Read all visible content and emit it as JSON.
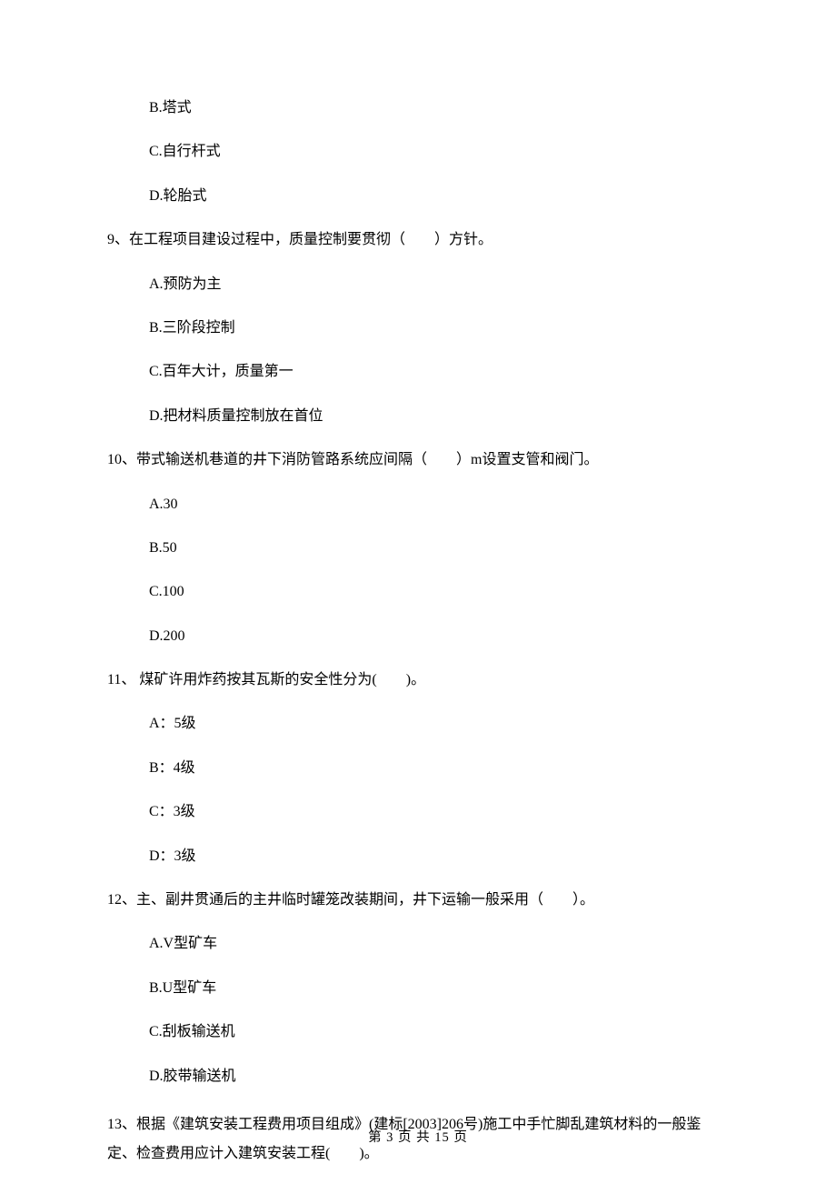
{
  "q8": {
    "opt_b": "B.塔式",
    "opt_c": "C.自行杆式",
    "opt_d": "D.轮胎式"
  },
  "q9": {
    "stem": "9、在工程项目建设过程中，质量控制要贯彻（　　）方针。",
    "opt_a": "A.预防为主",
    "opt_b": "B.三阶段控制",
    "opt_c": "C.百年大计，质量第一",
    "opt_d": "D.把材料质量控制放在首位"
  },
  "q10": {
    "stem": "10、带式输送机巷道的井下消防管路系统应间隔（　　）m设置支管和阀门。",
    "opt_a": "A.30",
    "opt_b": "B.50",
    "opt_c": "C.100",
    "opt_d": "D.200"
  },
  "q11": {
    "stem": "11、 煤矿许用炸药按其瓦斯的安全性分为(　　)。",
    "opt_a": "A：5级",
    "opt_b": "B：4级",
    "opt_c": "C：3级",
    "opt_d": "D：3级"
  },
  "q12": {
    "stem": "12、主、副井贯通后的主井临时罐笼改装期间，井下运输一般采用（　　）。",
    "opt_a": "A.V型矿车",
    "opt_b": "B.U型矿车",
    "opt_c": "C.刮板输送机",
    "opt_d": "D.胶带输送机"
  },
  "q13": {
    "stem": "13、根据《建筑安装工程费用项目组成》(建标[2003]206号)施工中手忙脚乱建筑材料的一般鉴定、检查费用应计入建筑安装工程(　　)。"
  },
  "footer": "第 3 页 共 15 页"
}
